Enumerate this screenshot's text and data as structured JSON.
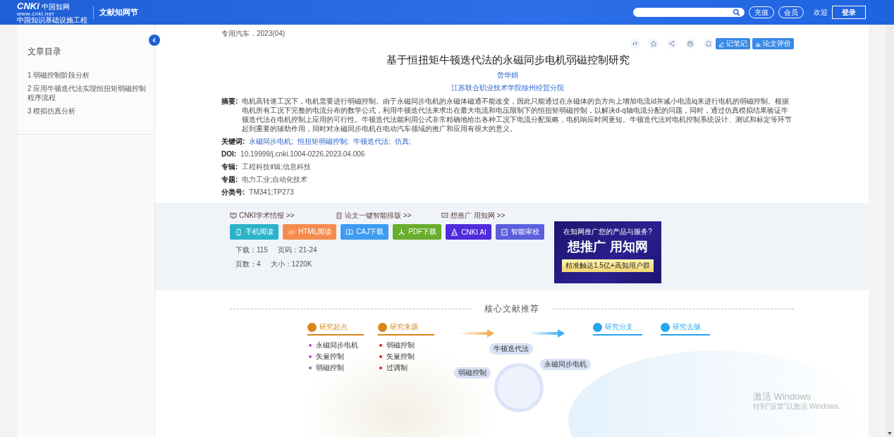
{
  "header": {
    "logo_mark": "CNKi",
    "logo_name": "中国知网",
    "logo_url": "www.cnki.net",
    "logo_subtitle": "中国知识基础设施工程",
    "site_name": "文献知网节",
    "buttons": [
      "充值",
      "会员"
    ],
    "welcome": "欢迎",
    "login": "登录"
  },
  "sidebar": {
    "title": "文章目录",
    "items": [
      "1 弱磁控制阶段分析",
      "2 应用牛顿迭代法实现恒扭矩弱磁控制程序流程",
      "3 模拟仿真分析"
    ]
  },
  "article": {
    "source": "专用汽车．2023(04)",
    "tools": [
      {
        "kind": "icon"
      },
      {
        "kind": "icon"
      },
      {
        "kind": "icon"
      },
      {
        "kind": "icon"
      },
      {
        "kind": "icon"
      },
      {
        "kind": "button",
        "label": "记笔记"
      },
      {
        "kind": "button",
        "label": "论文评价"
      }
    ],
    "title": "基于恒扭矩牛顿迭代法的永磁同步电机弱磁控制研究",
    "author": "曾华娟",
    "affiliation": "江苏联合职业技术学院徐州经贸分院",
    "abstract": {
      "label": "摘要:",
      "text": "电机高转速工况下，电机需要进行弱磁控制。由于永磁同步电机的永磁体磁通不能改变，因此只能通过在永磁体的负方向上增加电流id并减小电流iq来进行电机的弱磁控制。根据电机所有工况下完整的电流分布的数学公式，利用牛顿迭代法来求出在最大电流和电压限制下的恒扭矩弱磁控制，以解决d-q轴电流分配的问题，同时，通过仿真模拟结果验证牛顿迭代法在电机控制上应用的可行性。牛顿迭代法能利用公式非常精确地给出各种工况下电流分配策略，电机响应时间更短。牛顿迭代法对电机控制系统设计、测试和标定等环节起到重要的辅助作用，同时对永磁同步电机在电动汽车领域的推广和应用有很大的意义。"
    },
    "keywords": {
      "label": "关键词:",
      "items": [
        "永磁同步电机;",
        "恒扭矩弱磁控制;",
        "牛顿迭代法;",
        "仿真;"
      ]
    },
    "fields": [
      {
        "label": "DOI:",
        "value": "10.19999/j.cnki.1004-0226.2023.04.006"
      },
      {
        "label": "专辑:",
        "value": "工程科技Ⅱ辑;信息科技"
      },
      {
        "label": "专题:",
        "value": "电力工业;自动化技术"
      },
      {
        "label": "分类号:",
        "value": "TM341;TP273"
      }
    ]
  },
  "downloads": {
    "links": [
      "CNKI学术情报 >>",
      "论文一键智能排版 >>",
      "想推广 用知网 >>"
    ],
    "buttons": [
      {
        "label": "手机阅读",
        "color": "#2db3c9"
      },
      {
        "label": "HTML阅读",
        "color": "#f58c4f"
      },
      {
        "label": "CAJ下载",
        "color": "#3d9bf2"
      },
      {
        "label": "PDF下载",
        "color": "#68ad2c"
      },
      {
        "label": "CNKI AI",
        "color": "#4f2bdc"
      },
      {
        "label": "智能审校",
        "color": "#5b5fdc"
      }
    ],
    "stats": [
      [
        "下载：115",
        "页码：21-24"
      ],
      [
        "页数：4",
        "大小：1220K"
      ]
    ],
    "ad": {
      "question": "在知网推广您的产品与服务?",
      "slogan": "想推广 用知网",
      "band": "精准触达1.5亿+高知用户群"
    }
  },
  "recommend": {
    "title": "核心文献推荐",
    "columns": [
      {
        "heading": "研究起点",
        "color": "#d9861a",
        "items": [
          "永磁同步电机",
          "矢量控制",
          "弱磁控制"
        ]
      },
      {
        "heading": "研究来源",
        "color": "#d9861a",
        "items": [
          "弱磁控制",
          "矢量控制",
          "过调制"
        ]
      },
      {
        "heading": "研究分支",
        "color": "#27a3f0"
      },
      {
        "heading": "研究去脉",
        "color": "#27a3f0"
      }
    ],
    "bubbles": [
      "牛顿迭代法",
      "永磁同步电机",
      "弱磁控制"
    ]
  },
  "watermark": {
    "title": "激活 Windows",
    "hint": "转到\"设置\"以激活 Windows。"
  }
}
